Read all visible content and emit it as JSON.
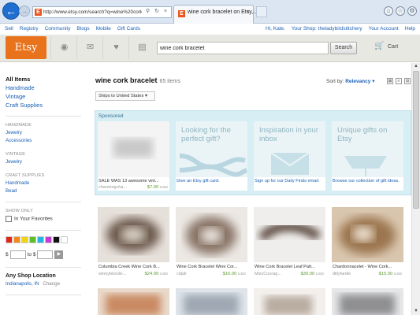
{
  "browser": {
    "url": "http://www.etsy.com/search?q=wine%20cork%20br",
    "tab_title": "wine cork bracelet on Etsy,...",
    "tab_close": "×"
  },
  "topnav": {
    "left": [
      "Sell",
      "Registry",
      "Community",
      "Blogs",
      "Mobile",
      "Gift Cards"
    ],
    "right": [
      "Hi, Kate.",
      "Your Shop: theladybirdstitchery",
      "Your Account",
      "Help"
    ]
  },
  "header": {
    "logo": "Etsy",
    "search_value": "wine cork bracelet",
    "search_button": "Search",
    "cart_label": "Cart"
  },
  "sidebar": {
    "all_items": "All Items",
    "top_categories": [
      "Handmade",
      "Vintage",
      "Craft Supplies"
    ],
    "handmade_title": "HANDMADE",
    "handmade_items": [
      "Jewelry",
      "Accessories"
    ],
    "vintage_title": "VINTAGE",
    "vintage_items": [
      "Jewelry"
    ],
    "craft_title": "CRAFT SUPPLIES",
    "craft_items": [
      "Handmade",
      "Bead"
    ],
    "show_only_title": "SHOW ONLY",
    "favorites_label": "In Your Favorites",
    "swatch_colors": [
      "#e0261f",
      "#f08a1c",
      "#f3d21a",
      "#5cbf2a",
      "#27b4e3",
      "#c43ad6",
      "#111111",
      "#ffffff"
    ],
    "price_prefix": "$",
    "price_to": "to $",
    "location_title": "Any Shop Location",
    "location_value": "Indianapolis, IN",
    "location_change": "Change"
  },
  "results": {
    "title": "wine cork bracelet",
    "count": "65 items",
    "ships_to": "Ships to United States",
    "sort_label": "Sort by:",
    "sort_value": "Relevancy"
  },
  "sponsored": {
    "label": "Sponsored",
    "item": {
      "title": "SALE WAS 13 awesome vint...",
      "shop": "charmingcha...",
      "price": "$7.00",
      "currency": "USD"
    },
    "promos": [
      {
        "heading": "Looking for the perfect gift?",
        "link": "Give an Etsy gift card."
      },
      {
        "heading": "Inspiration in your inbox",
        "link": "Sign up for our Daily Finds email."
      },
      {
        "heading": "Unique gifts on Etsy",
        "link": "Browse our collection of gift ideas."
      }
    ]
  },
  "products": [
    {
      "title": "Columbia Creek Wine Cork B...",
      "shop": "wineyblonde...",
      "price": "$24.99",
      "currency": "USD"
    },
    {
      "title": "Wine Cork Bracelet Wine Cor...",
      "shop": "cdjall",
      "price": "$16.00",
      "currency": "USD"
    },
    {
      "title": "Wine Cork Bracelet Leaf Patt...",
      "shop": "MiscCourag...",
      "price": "$30.00",
      "currency": "USD"
    },
    {
      "title": "Chardonnacelet - Wine Cork...",
      "shop": "dillyfardle",
      "price": "$15.00",
      "currency": "USD"
    }
  ]
}
